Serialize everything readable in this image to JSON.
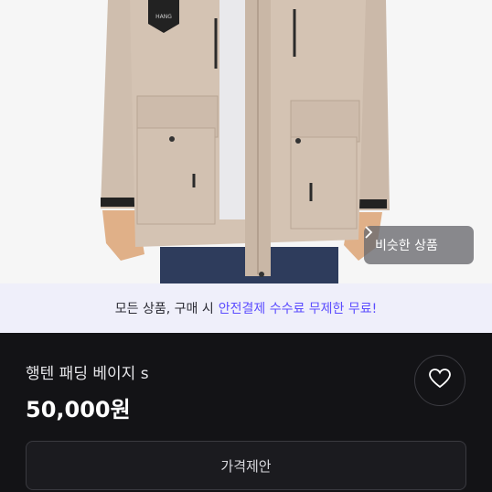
{
  "product_image": {
    "icon": "product-photo"
  },
  "similar_button": {
    "label": "비슷한 상품",
    "icon": "chevron-right-icon"
  },
  "banner": {
    "prefix": "모든 상품, 구매 시",
    "highlight": "안전결제 수수료 무제한 무료!",
    "highlight_color": "#5b4cff"
  },
  "product": {
    "title": "행텐 패딩 베이지 s",
    "price": "50,000원"
  },
  "like_button": {
    "icon": "heart-icon"
  },
  "offer_button": {
    "label": "가격제안"
  },
  "colors": {
    "background": "#131316",
    "banner_bg": "#efeffa",
    "jacket": "#d4c3b3"
  }
}
